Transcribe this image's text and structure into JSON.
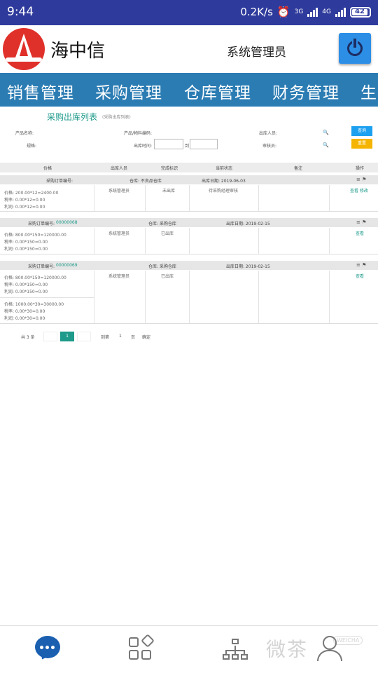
{
  "status_bar": {
    "time": "9:44",
    "net_speed": "0.2K/s",
    "signal_1": "3G",
    "signal_2": "4G",
    "battery": "42"
  },
  "header": {
    "brand": "海中信",
    "user": "系统管理员",
    "logout_icon": "power-icon"
  },
  "nav": {
    "items": [
      "销售管理",
      "采购管理",
      "仓库管理",
      "财务管理",
      "生"
    ]
  },
  "page": {
    "title": "采购出库列表",
    "subtitle": "(采购出库列表)",
    "filters": {
      "product_name_label": "产品名称:",
      "product_code_label": "产品/物料编码:",
      "outbound_person_label": "出库人员:",
      "spec_label": "规格:",
      "outbound_time_label": "出库时间:",
      "to_label": "到",
      "auditor_label": "审核员:",
      "search_button": "查询",
      "reset_button": "重置"
    },
    "columns": [
      "价格",
      "出库人员",
      "完成标识",
      "当前状态",
      "备注",
      "操作"
    ],
    "groups": [
      {
        "order_no_label": "采购订单编号:",
        "order_no": "",
        "warehouse": "仓库: 不良品仓库",
        "date": "出库日期: 2019-06-03",
        "price_lines": [
          "价格: 200.00*12=2400.00",
          "税率: 0.00*12=0.00",
          "利润: 0.00*12=0.00"
        ],
        "person": "系统管理员",
        "flag": "未出库",
        "status": "待采购经理审核",
        "ops": "查看 修改"
      },
      {
        "order_no_label": "采购订单编号:",
        "order_no": "00000068",
        "warehouse": "仓库: 采购仓库",
        "date": "出库日期: 2019-02-15",
        "price_lines": [
          "价格: 800.00*150=120000.00",
          "税率: 0.00*150=0.00",
          "利润: 0.00*150=0.00"
        ],
        "person": "系统管理员",
        "flag": "已出库",
        "status": "",
        "ops": "查看"
      },
      {
        "order_no_label": "采购订单编号:",
        "order_no": "00000069",
        "warehouse": "仓库: 采购仓库",
        "date": "出库日期: 2019-02-15",
        "price_lines": [
          "价格: 800.00*150=120000.00",
          "税率: 0.00*150=0.00",
          "利润: 0.00*150=0.00"
        ],
        "price_lines_2": [
          "价格: 1000.00*30=30000.00",
          "税率: 0.00*30=0.00",
          "利润: 0.00*30=0.00"
        ],
        "person": "系统管理员",
        "flag": "已出库",
        "status": "",
        "ops": "查看"
      }
    ],
    "pager": {
      "total": "共 3 条",
      "current": "1",
      "goto_label": "到第",
      "goto_value": "1",
      "page_label": "页",
      "confirm": "确定"
    }
  },
  "bottom_nav": {
    "tabs": [
      "chat-icon",
      "apps-icon",
      "network-icon",
      "user-icon"
    ],
    "watermark": "微茶",
    "watermark_small": "WEICHA"
  },
  "colors": {
    "statusbar": "#2f3b9c",
    "nav": "#2b7cb3",
    "accent": "#1d9a8a",
    "search": "#1ea0f0",
    "reset": "#f5b400"
  }
}
